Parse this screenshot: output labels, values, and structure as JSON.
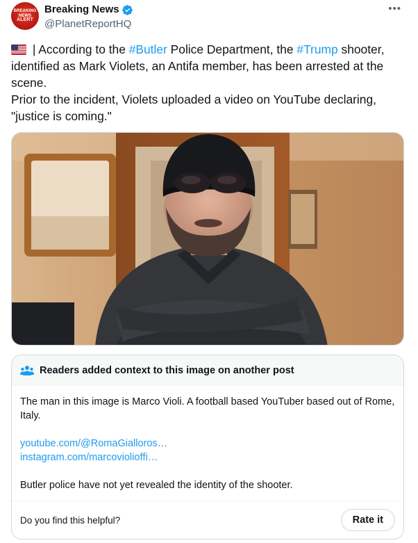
{
  "author": {
    "display_name": "Breaking News",
    "handle": "@PlanetReportHQ",
    "avatar_lines": [
      "BREAKING",
      "NEWS",
      "ALERT"
    ],
    "verified_icon": "verified-badge-icon"
  },
  "more_label": "•••",
  "tweet": {
    "flag_icon": "us-flag-icon",
    "seg1": " | According to the ",
    "tag1": "#Butler",
    "seg2": " Police Department, the ",
    "tag2": "#Trump",
    "seg3": " shooter, identified as Mark Violets, an Antifa member, has been arrested at the scene.\nPrior to the incident, Violets uploaded a video on YouTube declaring, \"justice is coming.\""
  },
  "community_note": {
    "title": "Readers added context to this image on another post",
    "body": "The man in this image is Marco Violi. A football based YouTuber based out of Rome, Italy.",
    "link1": "youtube.com/@RomaGialloros…",
    "link2": "instagram.com/marcovioliofﬁ…",
    "footer_text": "Butler police have not yet revealed the identity of the shooter.",
    "helpful_question": "Do you find this helpful?",
    "rate_button": "Rate it"
  },
  "colors": {
    "accent": "#1d9bf0",
    "text": "#0f1419",
    "muted": "#536471",
    "border": "#cfd9de"
  }
}
